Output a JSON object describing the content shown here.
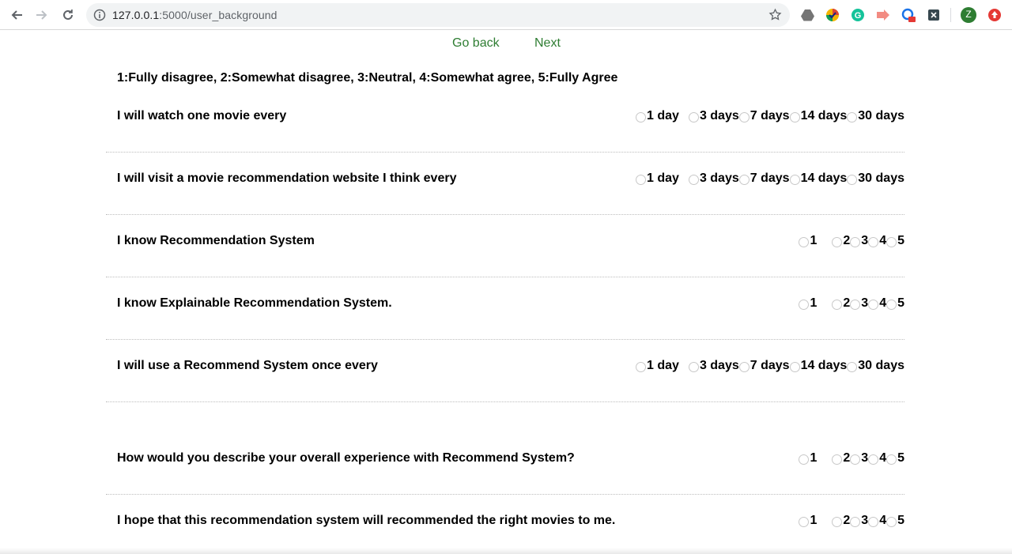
{
  "browser": {
    "url_host": "127.0.0.1",
    "url_path": ":5000/user_background",
    "profile_initial": "Z"
  },
  "nav": {
    "back_label": "Go back",
    "next_label": "Next"
  },
  "scale_text": "1:Fully disagree, 2:Somewhat disagree, 3:Neutral, 4:Somewhat agree, 5:Fully Agree",
  "questions": [
    {
      "text": "I will watch one movie every",
      "options": [
        "1 day",
        "3 days",
        "7 days",
        "14 days",
        "30 days"
      ]
    },
    {
      "text": "I will visit a movie recommendation website I think every",
      "options": [
        "1 day",
        "3 days",
        "7 days",
        "14 days",
        "30 days"
      ]
    },
    {
      "text": "I know Recommendation System",
      "options": [
        "1",
        "2",
        "3",
        "4",
        "5"
      ]
    },
    {
      "text": "I know Explainable Recommendation System.",
      "options": [
        "1",
        "2",
        "3",
        "4",
        "5"
      ]
    },
    {
      "text": "I will use a Recommend System once every",
      "options": [
        "1 day",
        "3 days",
        "7 days",
        "14 days",
        "30 days"
      ]
    },
    {
      "text": "How would you describe your overall experience with Recommend System?",
      "options": [
        "1",
        "2",
        "3",
        "4",
        "5"
      ]
    },
    {
      "text": "I hope that this recommendation system will recommended the right movies to me.",
      "options": [
        "1",
        "2",
        "3",
        "4",
        "5"
      ]
    }
  ]
}
